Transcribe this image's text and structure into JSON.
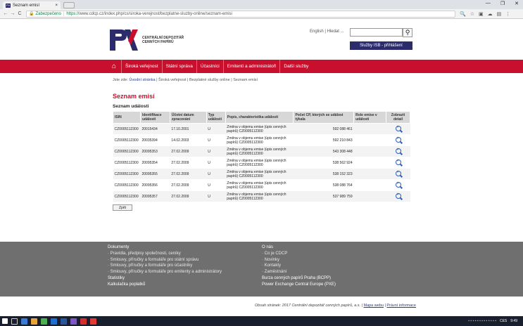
{
  "browser": {
    "tab_title": "Seznam emisí",
    "tab_close": "×",
    "secure_label": "Zabezpečeno",
    "url_https": "https://",
    "url_rest": "www.cdcp.cz/index.php/cs/siroka-verejnost/bezplatne-sluzby-online/seznam-emisi",
    "window_controls": [
      "—",
      "❐",
      "✕"
    ]
  },
  "header": {
    "logo_text_line1": "CENTRÁLNÍ DEPOZITÁŘ",
    "logo_text_line2": "CENNÝCH PAPÍRŮ",
    "lang_label": "English  |  Hledat ...",
    "search_placeholder": "",
    "isb_button": "Služby ISB - přihlášení"
  },
  "nav": {
    "items": [
      "Široká veřejnost",
      "Státní správa",
      "Účastníci",
      "Emitenti a administrátoři",
      "Další služby"
    ]
  },
  "breadcrumb": {
    "prefix": "Jste zde:",
    "home": "Úvodní stránka",
    "rest": " | Široká veřejnost | Bezplatné služby online | Seznam emisí"
  },
  "page": {
    "title": "Seznam emisí",
    "section": "Seznam událostí"
  },
  "table": {
    "headers": [
      "ISIN",
      "Identifikace události",
      "Účetní datum zpracování",
      "Typ události",
      "Popis, charakteristika události",
      "Počet CP, kterých se událost týkala",
      "Role emise v události",
      "Zobrazit detail"
    ],
    "rows": [
      [
        "CZ0005112300",
        "20015434",
        "17.10.2001",
        "U",
        "Změna v objemu emise (úpis cenných papírů) CZ0005112300",
        "592 088 461",
        ""
      ],
      [
        "CZ0005112300",
        "20035394",
        "14.02.2003",
        "U",
        "Změna v objemu emise (úpis cenných papírů) CZ0005112300",
        "592 210 843",
        ""
      ],
      [
        "CZ0005112300",
        "20095353",
        "27.02.2009",
        "U",
        "Změna v objemu emise (úpis cenných papírů) CZ0005112300",
        "543 308 448",
        ""
      ],
      [
        "CZ0005112300",
        "20095354",
        "27.02.2009",
        "U",
        "Změna v objemu emise (úpis cenných papírů) CZ0005112300",
        "538 562 924",
        ""
      ],
      [
        "CZ0005112300",
        "20095355",
        "27.02.2009",
        "U",
        "Změna v objemu emise (úpis cenných papírů) CZ0005112300",
        "538 152 323",
        ""
      ],
      [
        "CZ0005112300",
        "20095356",
        "27.02.2009",
        "U",
        "Změna v objemu emise (úpis cenných papírů) CZ0005112300",
        "538 088 764",
        ""
      ],
      [
        "CZ0005112300",
        "20095357",
        "27.02.2009",
        "U",
        "Změna v objemu emise (úpis cenných papírů) CZ0005112300",
        "537 989 759",
        ""
      ]
    ]
  },
  "back_button": "Zpět",
  "footer": {
    "col1": [
      "Dokumenty",
      "· Pravidla, předpisy společnosti, ceníky",
      "· Smlouvy, příručky a formuláře pro státní správu",
      "· Smlouvy, příručky a formuláře pro účastníky",
      "· Smlouvy, příručky a formuláře pro emitenty a administrátory",
      "Statistiky",
      "Kalkulačka poplatků"
    ],
    "col2": [
      "O nás",
      "· Co je CDCP",
      "· Novinky",
      "· Kontakty",
      "· Zaměstnání",
      "Burza cenných papírů Praha (BCPP)",
      "Power Exchange Central Europe (PXE)"
    ],
    "copyright": "Obsah stránek: 2017 Centrální depozitář cenných papírů, a.s. | ",
    "sitemap": "Mapa webu",
    "legal": "Právní informace"
  },
  "taskbar": {
    "lang": "CES",
    "time": "9:49"
  },
  "colors": {
    "brand_red": "#c8102e",
    "brand_navy": "#2c2c6c",
    "footer_gray": "#6f6f6f"
  }
}
